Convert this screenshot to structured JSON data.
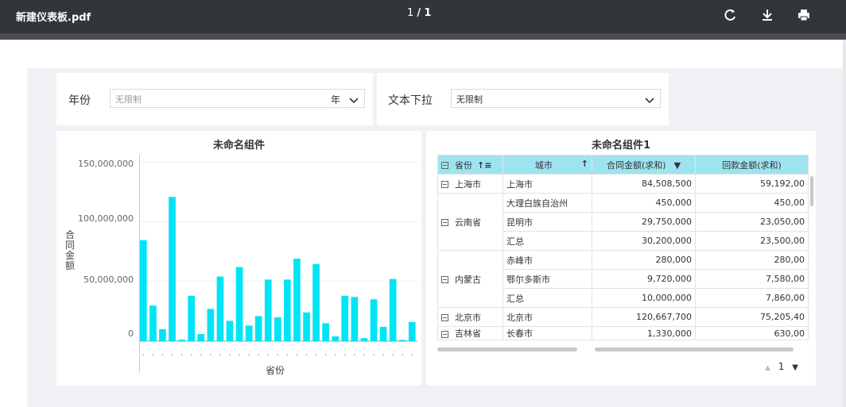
{
  "toolbar": {
    "file_name": "新建仪表板.pdf",
    "page_current": "1",
    "page_separator": "/",
    "page_total": "1",
    "icons": [
      "rotate-icon",
      "download-icon",
      "print-icon"
    ]
  },
  "filters": {
    "year": {
      "label": "年份",
      "value": "无限制",
      "unit": "年"
    },
    "text_dropdown": {
      "label": "文本下拉",
      "value": "无限制"
    }
  },
  "chart_panel": {
    "title": "未命名组件",
    "chart_data": {
      "type": "bar",
      "title": "未命名组件",
      "xlabel": "省份",
      "ylabel": "合同金额",
      "ylim": [
        0,
        150000000
      ],
      "yticks": [
        "150,000,000",
        "100,000,000",
        "50,000,000",
        "0"
      ],
      "values": [
        84508500,
        29750000,
        10000000,
        120667700,
        1330000,
        38000000,
        6000000,
        27000000,
        54000000,
        17000000,
        62000000,
        13000000,
        21000000,
        51500000,
        20000000,
        51500000,
        69000000,
        24000000,
        64500000,
        15000000,
        4000000,
        38000000,
        37000000,
        2500000,
        35000000,
        12000000,
        52000000,
        1000000,
        16000000
      ],
      "bar_color": "#00e5f5"
    }
  },
  "table_panel": {
    "title": "未命名组件1",
    "headers": [
      "省份",
      "城市",
      "合同金额(求和)",
      "回款金额(求和)"
    ],
    "rows": [
      {
        "province": "上海市",
        "city": "上海市",
        "contract": "84,508,500",
        "payment": "59,192,00"
      },
      {
        "province": "",
        "city": "大理白族自治州",
        "contract": "450,000",
        "payment": "450,00"
      },
      {
        "province": "云南省",
        "city": "昆明市",
        "contract": "29,750,000",
        "payment": "23,050,00"
      },
      {
        "province": "",
        "city": "汇总",
        "contract": "30,200,000",
        "payment": "23,500,00"
      },
      {
        "province": "",
        "city": "赤峰市",
        "contract": "280,000",
        "payment": "280,00"
      },
      {
        "province": "内蒙古",
        "city": "鄂尔多斯市",
        "contract": "9,720,000",
        "payment": "7,580,00"
      },
      {
        "province": "",
        "city": "汇总",
        "contract": "10,000,000",
        "payment": "7,860,00"
      },
      {
        "province": "北京市",
        "city": "北京市",
        "contract": "120,667,700",
        "payment": "75,205,40"
      },
      {
        "province": "吉林省",
        "city": "长春市",
        "contract": "1,330,000",
        "payment": "630,00"
      }
    ],
    "pager": {
      "current": "1"
    },
    "header_color": "#9ee4f0"
  }
}
